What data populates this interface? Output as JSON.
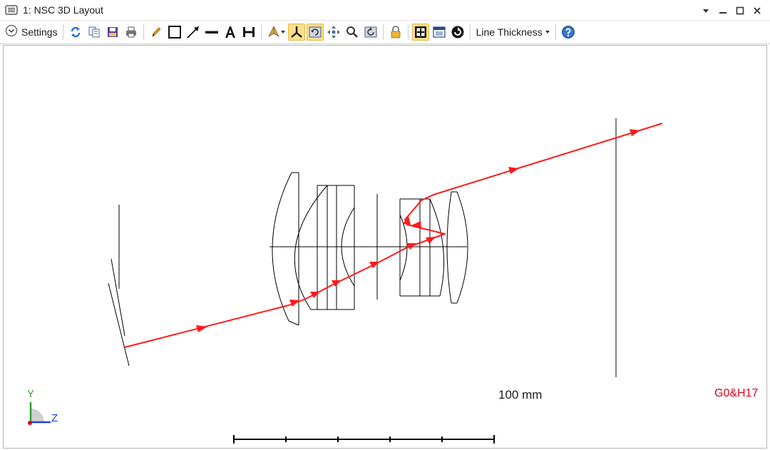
{
  "window": {
    "title": "1: NSC 3D Layout"
  },
  "toolbar": {
    "settings_label": "Settings",
    "line_thickness_label": "Line Thickness"
  },
  "icons": {
    "title": "layout-window-icon",
    "settings": "chevron-down-circle-icon",
    "refresh": "refresh-icon",
    "copy": "copy-icon",
    "save": "save-icon",
    "print": "print-icon",
    "pencil": "pencil-icon",
    "rectangle": "rectangle-icon",
    "arrow": "arrow-line-icon",
    "line": "line-icon",
    "text": "text-icon",
    "dimension": "dimension-icon",
    "rotate": "rotate-view-icon",
    "axes": "axes-icon",
    "fit": "fit-view-icon",
    "pan": "pan-icon",
    "zoom": "zoom-icon",
    "reset": "reset-view-icon",
    "lock": "lock-icon",
    "frame": "frame-icon",
    "window": "window-icon",
    "stop": "stop-icon",
    "help": "help-icon"
  },
  "toolbar_state": {
    "axes_active": true,
    "fit_active": true,
    "frame_active": true
  },
  "layout": {
    "scale_bar_label": "100 mm",
    "config_label": "G0&H17",
    "axis_labels": {
      "y": "Y",
      "z": "Z"
    }
  },
  "colors": {
    "ray": "#ff1a1a",
    "optics": "#000000",
    "config_label": "#e0001a",
    "axis_y": "#2ea02e",
    "axis_z": "#1f3fd6",
    "active_button": "#ffe08a"
  }
}
